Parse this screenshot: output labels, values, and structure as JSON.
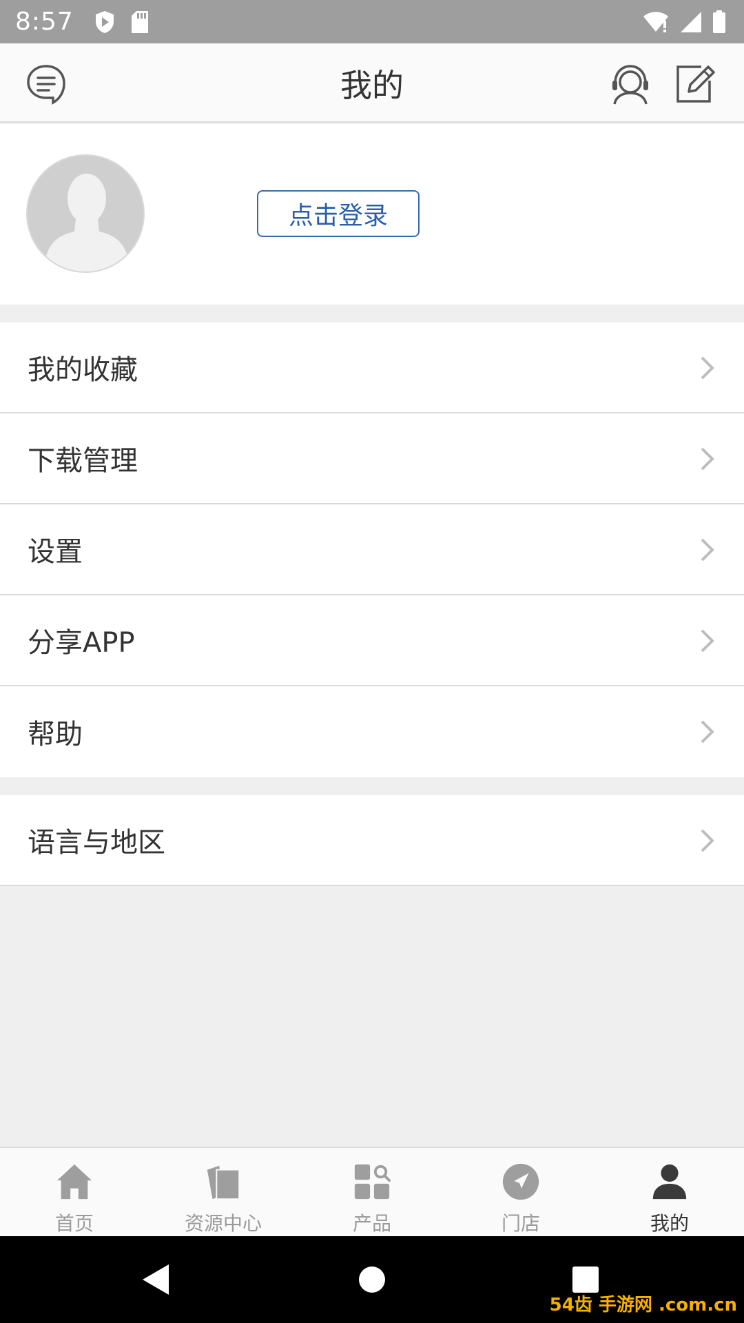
{
  "status_bar": {
    "time": "8:57"
  },
  "header": {
    "title": "我的"
  },
  "profile": {
    "login_label": "点击登录"
  },
  "menu_group_1": [
    {
      "label": "我的收藏"
    },
    {
      "label": "下载管理"
    },
    {
      "label": "设置"
    },
    {
      "label": "分享APP"
    },
    {
      "label": "帮助"
    }
  ],
  "menu_group_2": [
    {
      "label": "语言与地区"
    }
  ],
  "tabs": [
    {
      "label": "首页",
      "icon": "home-icon"
    },
    {
      "label": "资源中心",
      "icon": "documents-icon"
    },
    {
      "label": "产品",
      "icon": "grid-search-icon"
    },
    {
      "label": "门店",
      "icon": "navigation-icon"
    },
    {
      "label": "我的",
      "icon": "user-icon",
      "active": true
    }
  ],
  "watermark": "54齿 手游网 .com.cn",
  "colors": {
    "accent": "#2a5ea8",
    "status_bar": "#9e9e9e",
    "background": "#efefef"
  }
}
